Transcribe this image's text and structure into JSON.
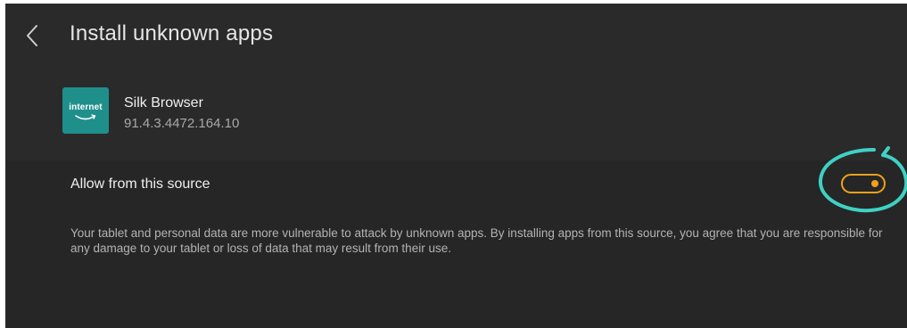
{
  "header": {
    "title": "Install unknown apps",
    "back_icon": "chevron-left-icon"
  },
  "app": {
    "icon_label": "internet",
    "icon_color": "#1f8f8c",
    "name": "Silk Browser",
    "version": "91.4.3.4472.164.10"
  },
  "setting": {
    "label": "Allow from this source",
    "toggle_state": "on",
    "toggle_color": "#f0a11c",
    "highlight_color": "#3fd1c4"
  },
  "warning": {
    "text": "Your tablet and personal data are more vulnerable to attack by unknown apps. By installing apps from this source, you agree that you are responsible for any damage to your tablet or loss of data that may result from their use."
  }
}
